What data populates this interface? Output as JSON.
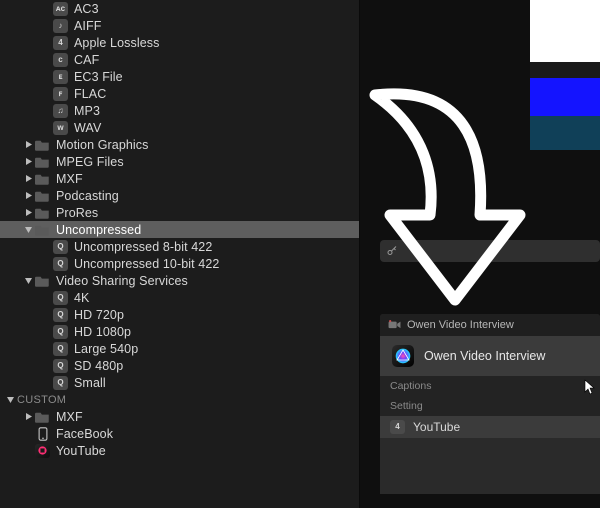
{
  "sidebar": {
    "audio_formats": [
      {
        "icon_text": "ᴀᴄ",
        "label": "AC3"
      },
      {
        "icon_text": "♪",
        "label": "AIFF"
      },
      {
        "icon_text": "4",
        "label": "Apple Lossless"
      },
      {
        "icon_text": "ᴄ",
        "label": "CAF"
      },
      {
        "icon_text": "ᴇ",
        "label": "EC3 File"
      },
      {
        "icon_text": "ꜰ",
        "label": "FLAC"
      },
      {
        "icon_text": "♫",
        "label": "MP3"
      },
      {
        "icon_text": "ᴡ",
        "label": "WAV"
      }
    ],
    "categories_top": [
      {
        "label": "Motion Graphics",
        "expanded": false
      },
      {
        "label": "MPEG Files",
        "expanded": false
      },
      {
        "label": "MXF",
        "expanded": false
      },
      {
        "label": "Podcasting",
        "expanded": false
      },
      {
        "label": "ProRes",
        "expanded": false
      }
    ],
    "uncompressed": {
      "label": "Uncompressed",
      "children": [
        {
          "icon_text": "Q",
          "label": "Uncompressed 8-bit 422"
        },
        {
          "icon_text": "Q",
          "label": "Uncompressed 10-bit 422"
        }
      ]
    },
    "video_sharing": {
      "label": "Video Sharing Services",
      "children": [
        {
          "icon_text": "Q",
          "label": "4K"
        },
        {
          "icon_text": "Q",
          "label": "HD 720p"
        },
        {
          "icon_text": "Q",
          "label": "HD 1080p"
        },
        {
          "icon_text": "Q",
          "label": "Large 540p"
        },
        {
          "icon_text": "Q",
          "label": "SD 480p"
        },
        {
          "icon_text": "Q",
          "label": "Small"
        }
      ]
    },
    "custom_heading": "CUSTOM",
    "custom": [
      {
        "type": "folder",
        "label": "MXF",
        "expanded": false
      },
      {
        "type": "phone",
        "label": "FaceBook"
      },
      {
        "type": "app",
        "label": "YouTube"
      }
    ]
  },
  "share": {
    "header_title": "Owen Video Interview",
    "project_title": "Owen Video Interview",
    "captions_label": "Captions",
    "setting_label": "Setting",
    "setting_value": "YouTube",
    "setting_icon_text": "4"
  },
  "colors": {
    "bg": "#1c1c1c",
    "selected": "#5e5e5e",
    "panel": "#2a2a2a",
    "panel_row": "#3b3b3b"
  }
}
